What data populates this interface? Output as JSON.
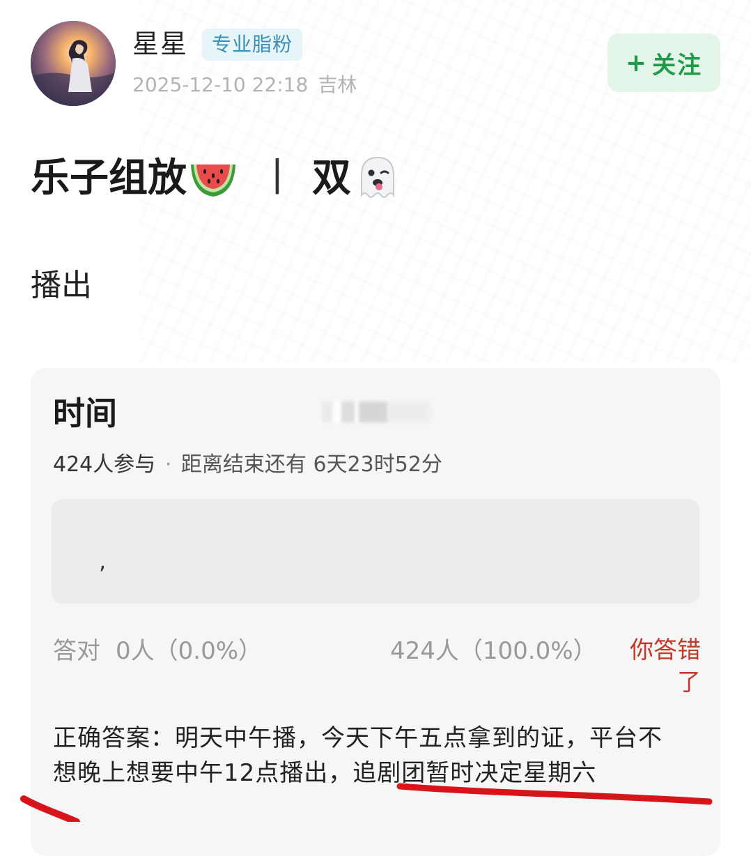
{
  "post": {
    "author": "星星",
    "badge": "专业脂粉",
    "datetime": "2025-12-10 22:18",
    "location": "吉林",
    "follow_label": "关注",
    "follow_plus": "+",
    "title_prefix": "乐子组放",
    "title_separator": "丨",
    "title_suffix": "双",
    "body": "播出"
  },
  "quiz": {
    "title": "时间",
    "participants": "424人参与",
    "dot": "·",
    "countdown": "距离结束还有 6天23时52分",
    "option_text": ",",
    "correct_label": "答对",
    "correct_count": "0人（0.0%）",
    "other_count": "424人（100.0%）",
    "wrong_notice": "你答错了",
    "answer": "正确答案：明天中午播，今天下午五点拿到的证，平台不想晚上想要中午12点播出，追剧团暂时决定星期六"
  },
  "colors": {
    "follow_green": "#1e9a48",
    "badge_blue": "#3a8fb7",
    "wrong_red": "#c0392b",
    "annotation_red": "#d8141a"
  },
  "icons": [
    "watermelon-icon",
    "ghost-icon"
  ]
}
